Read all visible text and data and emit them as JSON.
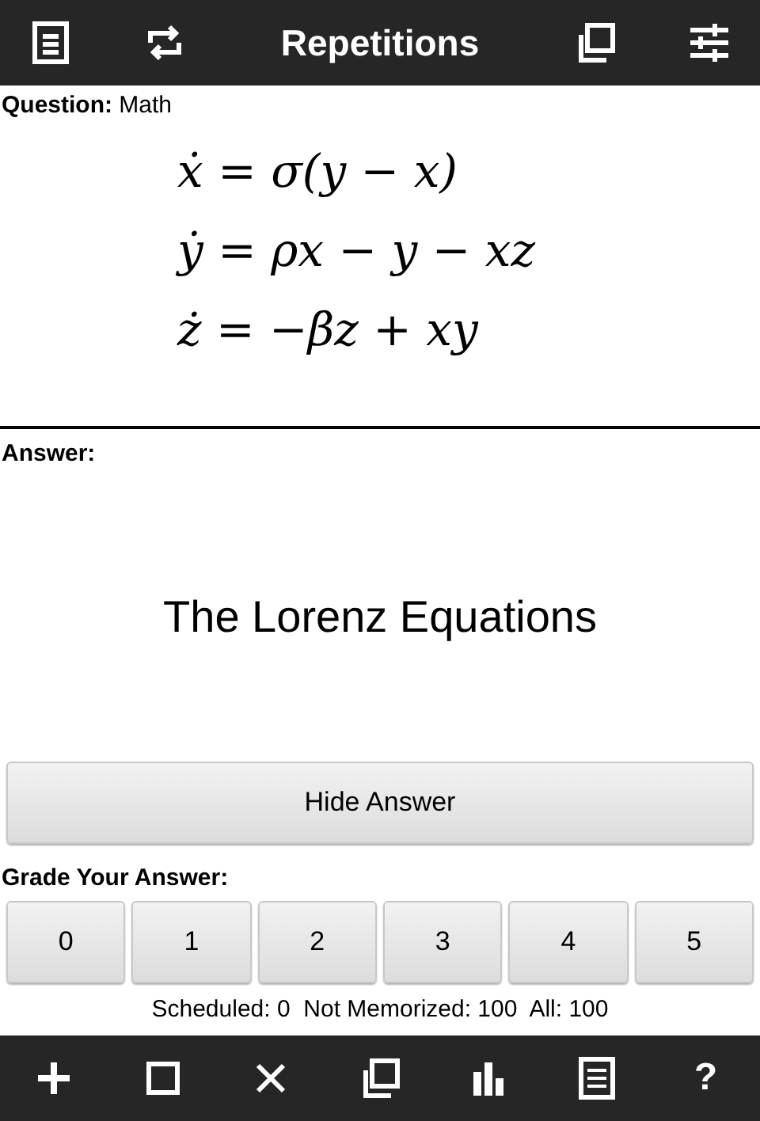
{
  "top_bar": {
    "title": "Repetitions",
    "left_icons": [
      {
        "kind": "notes"
      },
      {
        "kind": "repeat"
      }
    ],
    "right_icons": [
      {
        "kind": "copy"
      },
      {
        "kind": "sliders"
      }
    ]
  },
  "question": {
    "label": "Question:",
    "category": "Math",
    "lines": [
      "ẋ = σ(y − x)",
      "ẏ = ρx − y − xz",
      "ż = −βz + xy"
    ]
  },
  "answer": {
    "label": "Answer:",
    "text": "The Lorenz Equations"
  },
  "hide_button": "Hide Answer",
  "grade": {
    "label": "Grade Your Answer:",
    "buttons": [
      "0",
      "1",
      "2",
      "3",
      "4",
      "5"
    ]
  },
  "status": "Scheduled: 0  Not Memorized: 100  All: 100",
  "bottom_bar": [
    {
      "kind": "plus"
    },
    {
      "kind": "square"
    },
    {
      "kind": "close"
    },
    {
      "kind": "copy"
    },
    {
      "kind": "bars"
    },
    {
      "kind": "list"
    },
    {
      "kind": "text",
      "text": "?"
    }
  ]
}
